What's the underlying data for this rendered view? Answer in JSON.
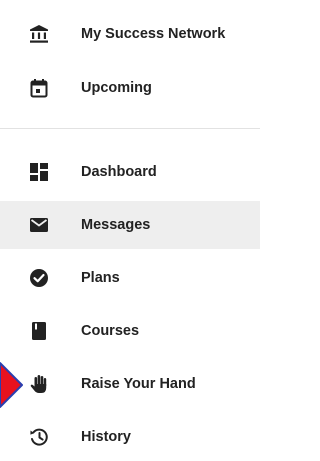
{
  "nav": {
    "items": [
      {
        "label": "My Success Network",
        "icon": "bank-icon"
      },
      {
        "label": "Upcoming",
        "icon": "calendar-icon"
      },
      {
        "label": "Dashboard",
        "icon": "dashboard-icon"
      },
      {
        "label": "Messages",
        "icon": "envelope-icon",
        "active": true
      },
      {
        "label": "Plans",
        "icon": "check-circle-icon"
      },
      {
        "label": "Courses",
        "icon": "book-icon"
      },
      {
        "label": "Raise Your Hand",
        "icon": "hand-icon"
      },
      {
        "label": "History",
        "icon": "history-icon"
      }
    ]
  },
  "colors": {
    "text": "#222222",
    "active_bg": "#eeeeee",
    "divider": "#e2e2e2",
    "pointer_fill": "#e8121e",
    "pointer_stroke": "#2a3fb0"
  }
}
